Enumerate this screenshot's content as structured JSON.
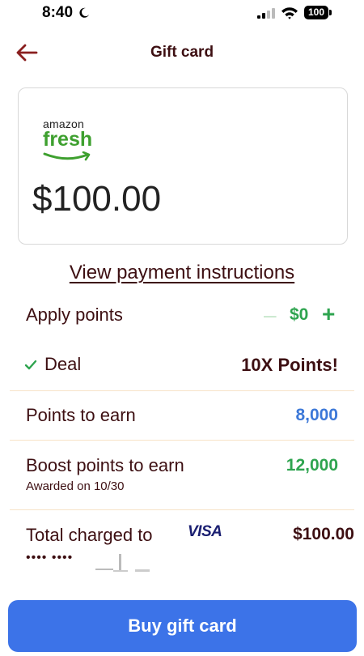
{
  "status_bar": {
    "time": "8:40",
    "battery": "100"
  },
  "nav": {
    "title": "Gift card"
  },
  "gift_card": {
    "brand_top": "amazon",
    "brand_bottom": "fresh",
    "amount": "$100.00"
  },
  "payment_link": "View payment instructions",
  "apply_points": {
    "label": "Apply points",
    "minus": "–",
    "value": "$0",
    "plus": "+"
  },
  "deal": {
    "label": "Deal",
    "value": "10X Points!"
  },
  "points_to_earn": {
    "label": "Points to earn",
    "value": "8,000"
  },
  "boost": {
    "label": "Boost points to earn",
    "sub": "Awarded on 10/30",
    "value": "12,000"
  },
  "total": {
    "label": "Total charged to",
    "card_brand": "VISA",
    "value": "$100.00",
    "masked": "•••• ••••"
  },
  "buy_button": "Buy gift card",
  "colors": {
    "accent_blue": "#3c73e8",
    "green": "#2ea44f",
    "maroon": "#3d0f12",
    "points_blue": "#3c78d8"
  },
  "icons": [
    "moon-icon",
    "signal-icon",
    "wifi-icon",
    "battery-icon",
    "back-arrow-icon",
    "amazon-smile-icon",
    "check-icon"
  ]
}
